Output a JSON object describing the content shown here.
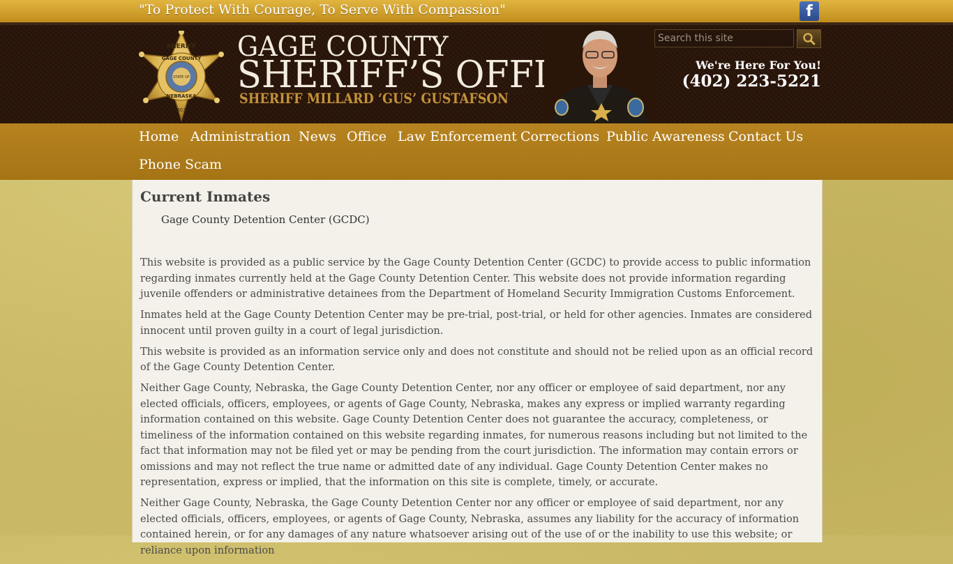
{
  "topbar": {
    "tagline": "\"To Protect With Courage, To Serve With Compassion\"",
    "facebook_icon": "facebook-icon",
    "facebook_letter": "f"
  },
  "header": {
    "badge_top": "SHERIFF",
    "badge_ring": "GAGE COUNTY",
    "badge_bottom": "NEBRASKA",
    "badge_center": "STATE OF",
    "badge_number": "903",
    "title_line1": "GAGE COUNTY",
    "title_line2": "SHERIFF’S OFFICE",
    "title_line3": "SHERIFF MILLARD ‘GUS’ GUSTAFSON",
    "search_placeholder": "Search this site",
    "search_icon": "search-icon",
    "here_for_you": "We're Here For You!",
    "phone": "(402) 223-5221"
  },
  "nav": {
    "items": [
      {
        "label": "Home"
      },
      {
        "label": "Administration"
      },
      {
        "label": "News"
      },
      {
        "label": "Office"
      },
      {
        "label": "Law Enforcement"
      },
      {
        "label": "Corrections"
      },
      {
        "label": "Public Awareness"
      },
      {
        "label": "Contact Us"
      },
      {
        "label": "Phone Scam"
      }
    ]
  },
  "content": {
    "title": "Current Inmates",
    "subtitle": "Gage County Detention Center (GCDC)",
    "paragraphs": [
      "This website is provided as a public service by the Gage County Detention Center (GCDC) to provide access to public information regarding inmates currently held at the Gage County Detention Center. This website does not provide information regarding juvenile offenders or administrative detainees from the Department of Homeland Security Immigration Customs Enforcement.",
      "Inmates held at the Gage County Detention Center may be pre-trial, post-trial, or held for other agencies. Inmates are considered innocent until proven guilty in a court of legal jurisdiction.",
      "This website is provided as an information service only and does not constitute and should not be relied upon as an official record of the Gage County Detention Center.",
      "Neither Gage County, Nebraska, the Gage County Detention Center, nor any officer or employee of said department, nor any elected officials, officers, employees, or agents of Gage County, Nebraska, makes any express or implied warranty regarding information contained on this website. Gage County Detention Center does not guarantee the accuracy, completeness, or timeliness of the information contained on this website regarding inmates, for numerous reasons including but not limited to the fact that information may not be filed yet or may be pending from the court jurisdiction. The information may contain errors or omissions and may not reflect the true name or admitted date of any individual. Gage County Detention Center makes no representation, express or implied, that the information on this site is complete, timely, or accurate.",
      "Neither Gage County, Nebraska, the Gage County Detention Center nor any officer or employee of said department, nor any elected officials, officers, employees, or agents of Gage County, Nebraska, assumes any liability for the accuracy of information contained herein, or for any damages of any nature whatsoever arising out of the use of or the inability to use this website; or reliance upon information"
    ]
  },
  "colors": {
    "topbar": "#d4a22f",
    "header_bg": "#2a1509",
    "nav_bg": "#ae7b1a",
    "content_bg": "#f3f1e9",
    "page_bg": "#c9b865",
    "accent_text": "#c2923a"
  }
}
